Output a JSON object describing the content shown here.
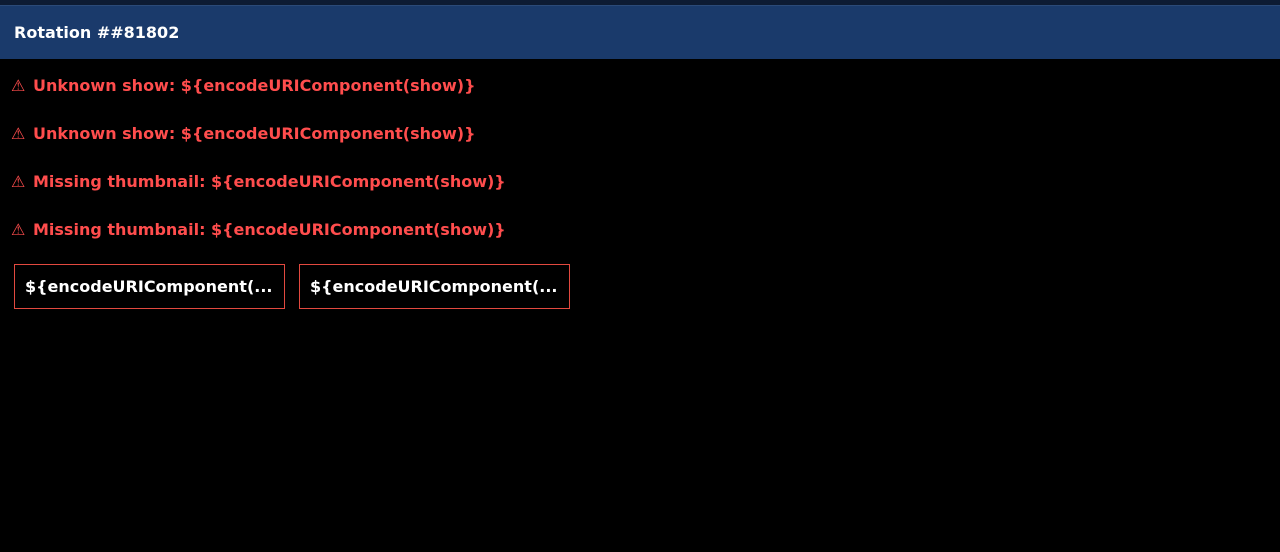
{
  "header": {
    "title": "Rotation ##81802"
  },
  "warnings": [
    {
      "icon": "⚠",
      "text": "Unknown show: ${encodeURIComponent(show)}"
    },
    {
      "icon": "⚠",
      "text": "Unknown show: ${encodeURIComponent(show)}"
    },
    {
      "icon": "⚠",
      "text": "Missing thumbnail: ${encodeURIComponent(show)}"
    },
    {
      "icon": "⚠",
      "text": "Missing thumbnail: ${encodeURIComponent(show)}"
    }
  ],
  "cards": [
    {
      "label": "${encodeURIComponent(..."
    },
    {
      "label": "${encodeURIComponent(..."
    }
  ],
  "colors": {
    "header_bg": "#1a3a6b",
    "warning_text": "#ff4d4d",
    "card_border": "#e2493f",
    "page_bg": "#000000"
  }
}
